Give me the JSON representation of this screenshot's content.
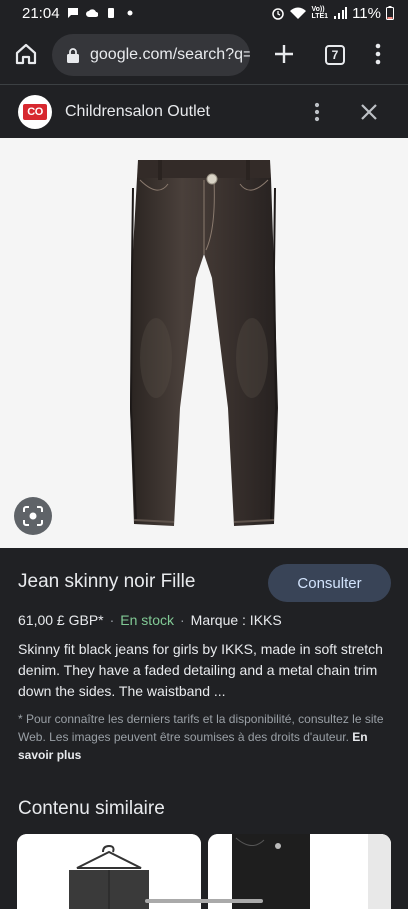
{
  "status": {
    "time": "21:04",
    "battery": "11%",
    "net": "Vo))\nLTE1"
  },
  "browser": {
    "url": "google.com/search?q=",
    "tab_count": "7"
  },
  "sheet": {
    "site_logo_text": "CO",
    "site_name": "Childrensalon Outlet"
  },
  "product": {
    "title": "Jean skinny noir Fille",
    "consult_label": "Consulter",
    "price": "61,00 £ GBP*",
    "stock": "En stock",
    "brand": "Marque : IKKS",
    "description": "Skinny fit black jeans for girls by IKKS, made in soft stretch denim. They have a faded detailing and a metal chain trim down the sides. The waistband ...",
    "disclaimer": "* Pour connaître les derniers tarifs et la disponibilité, consultez le site Web. Les images peuvent être soumises à des droits d'auteur.",
    "learn_more": "En savoir plus"
  },
  "similar": {
    "title": "Contenu similaire"
  },
  "colors": {
    "background": "#202124",
    "accent_button": "#394457",
    "stock_green": "#81c995"
  }
}
